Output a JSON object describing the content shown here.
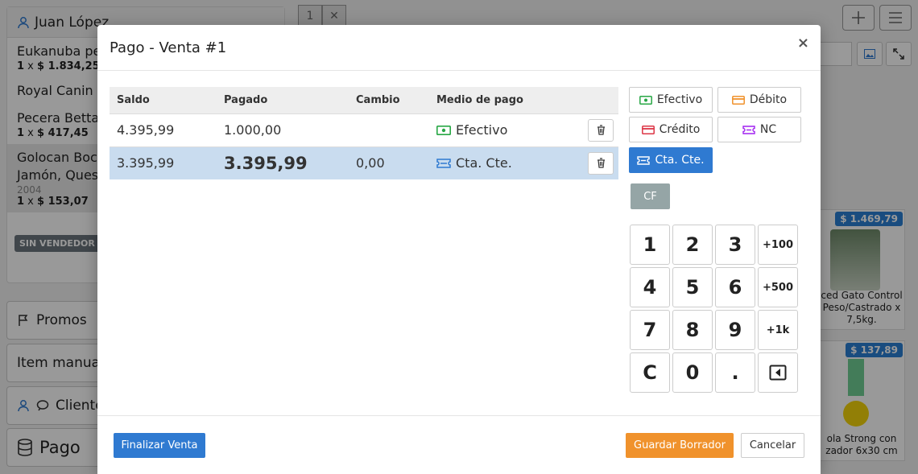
{
  "background": {
    "client_name": "Juan López",
    "cart": [
      {
        "name": "Eukanuba pe",
        "qty": "1",
        "price": "$ 1.834,25"
      },
      {
        "name": "Royal Canin C"
      },
      {
        "name": "Pecera Betta",
        "qty": "1",
        "price": "$ 417,45"
      },
      {
        "name": "Golocan Boc",
        "name2": "Jamón, Ques",
        "code": "2004",
        "qty": "1",
        "price": "$ 153,07"
      }
    ],
    "qty_separator": " x ",
    "sin_vendedor": "SIN VENDEDOR",
    "side_buttons": {
      "promos": "Promos",
      "item_manual": "Item manual",
      "clientes": "Cliente",
      "pago": "Pago"
    },
    "tab_number": "1",
    "tab_close": "✕",
    "products": [
      {
        "price": "$ 1.469,79",
        "name": "ced Gato Control Peso/Castrado x 7,5kg."
      },
      {
        "price": "$ 137,89",
        "name": "ola Strong con zador 6x30 cm"
      }
    ]
  },
  "modal": {
    "title": "Pago - Venta #1",
    "close": "×",
    "table": {
      "headers": [
        "Saldo",
        "Pagado",
        "Cambio",
        "Medio de pago"
      ],
      "rows": [
        {
          "saldo": "4.395,99",
          "pagado": "1.000,00",
          "cambio": "",
          "medio": "Efectivo"
        },
        {
          "saldo": "3.395,99",
          "pagado": "3.395,99",
          "cambio": "0,00",
          "medio": "Cta. Cte."
        }
      ]
    },
    "methods": {
      "efectivo": "Efectivo",
      "debito": "Débito",
      "credito": "Crédito",
      "nc": "NC",
      "cta_cte": "Cta. Cte."
    },
    "cf": "CF",
    "keypad": [
      "1",
      "2",
      "3",
      "+100",
      "4",
      "5",
      "6",
      "+500",
      "7",
      "8",
      "9",
      "+1k",
      "C",
      "0",
      ".",
      ""
    ],
    "footer": {
      "finalizar": "Finalizar Venta",
      "guardar": "Guardar Borrador",
      "cancelar": "Cancelar"
    }
  },
  "colors": {
    "primary": "#2f7ad1",
    "warning": "#f0922c",
    "efectivo_icon": "#28a745",
    "debito_icon": "#f0922c",
    "credito_icon": "#dc3545",
    "nc_icon": "#a020f0",
    "cta_icon": "#2f7ad1",
    "active_row": "#c9dcef"
  }
}
